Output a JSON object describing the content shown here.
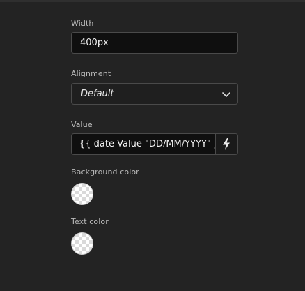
{
  "fields": {
    "width": {
      "label": "Width",
      "value": "400px"
    },
    "alignment": {
      "label": "Alignment",
      "value": "Default"
    },
    "value": {
      "label": "Value",
      "value": "{{ date Value \"DD/MM/YYYY\"  }}",
      "action_icon": "lightning-bolt-icon"
    },
    "background_color": {
      "label": "Background color"
    },
    "text_color": {
      "label": "Text color"
    }
  },
  "colors": {
    "background": "#232323",
    "input_background": "#0f0f0f",
    "border": "#4a4a4a",
    "label": "#b9b9b9",
    "text": "#f0f0f0"
  }
}
